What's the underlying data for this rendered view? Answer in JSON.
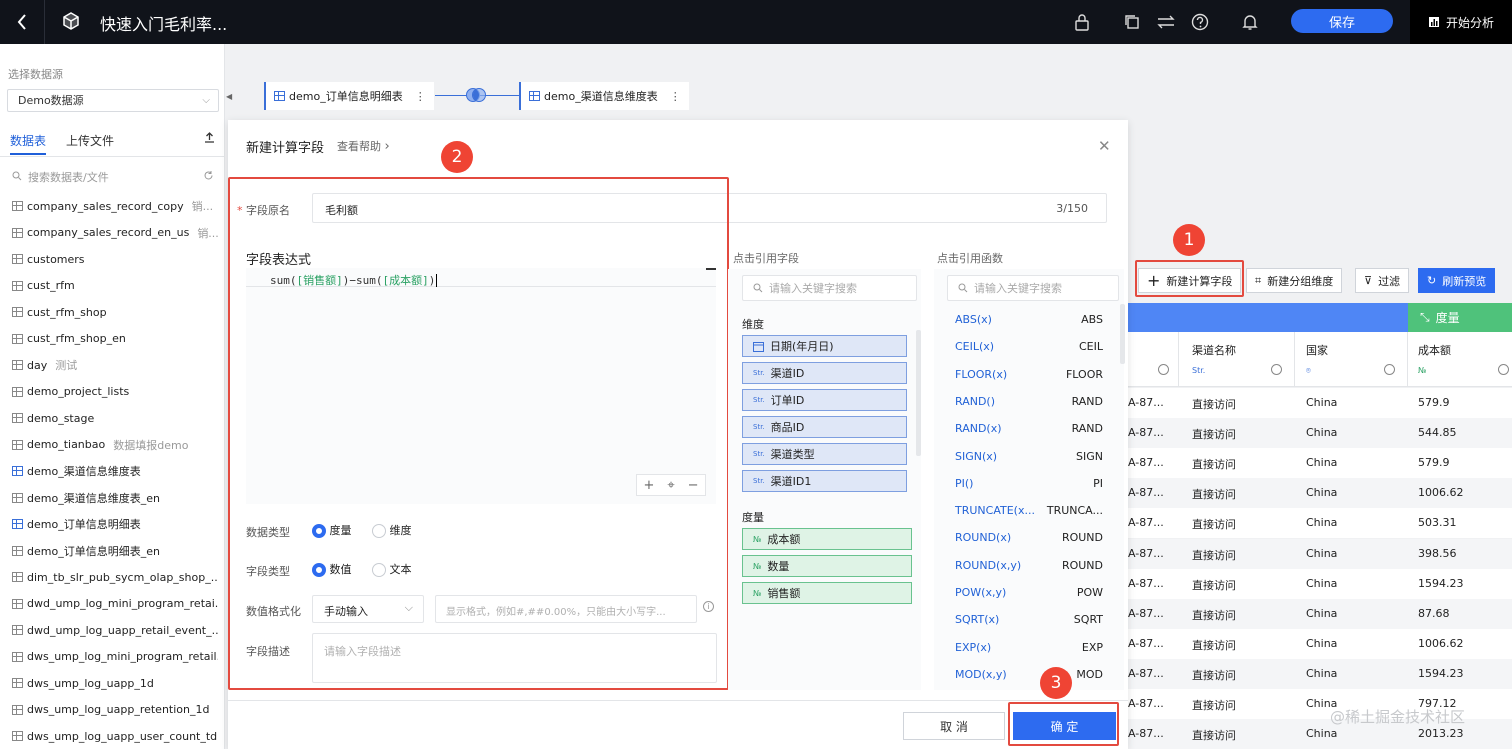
{
  "topbar": {
    "title": "快速入门毛利率...",
    "save_label": "保存",
    "analyze_label": "开始分析"
  },
  "sidebar": {
    "source_label": "选择数据源",
    "source_value": "Demo数据源",
    "tab_tables": "数据表",
    "tab_upload": "上传文件",
    "search_placeholder": "搜索数据表/文件",
    "tables": [
      {
        "name": "company_sales_record_copy",
        "desc": "销..."
      },
      {
        "name": "company_sales_record_en_us",
        "desc": "销..."
      },
      {
        "name": "customers",
        "desc": ""
      },
      {
        "name": "cust_rfm",
        "desc": ""
      },
      {
        "name": "cust_rfm_shop",
        "desc": ""
      },
      {
        "name": "cust_rfm_shop_en",
        "desc": ""
      },
      {
        "name": "day",
        "desc": "测试"
      },
      {
        "name": "demo_project_lists",
        "desc": ""
      },
      {
        "name": "demo_stage",
        "desc": ""
      },
      {
        "name": "demo_tianbao",
        "desc": "数据填报demo"
      },
      {
        "name": "demo_渠道信息维度表",
        "desc": ""
      },
      {
        "name": "demo_渠道信息维度表_en",
        "desc": ""
      },
      {
        "name": "demo_订单信息明细表",
        "desc": ""
      },
      {
        "name": "demo_订单信息明细表_en",
        "desc": ""
      },
      {
        "name": "dim_tb_slr_pub_sycm_olap_shop_...",
        "desc": ""
      },
      {
        "name": "dwd_ump_log_mini_program_retai...",
        "desc": ""
      },
      {
        "name": "dwd_ump_log_uapp_retail_event_...",
        "desc": ""
      },
      {
        "name": "dws_ump_log_mini_program_retail...",
        "desc": ""
      },
      {
        "name": "dws_ump_log_uapp_1d",
        "desc": ""
      },
      {
        "name": "dws_ump_log_uapp_retention_1d",
        "desc": ""
      },
      {
        "name": "dws_ump_log_uapp_user_count_td",
        "desc": ""
      }
    ]
  },
  "canvas": {
    "node_left": "demo_订单信息明细表",
    "node_right": "demo_渠道信息维度表"
  },
  "dialog": {
    "title": "新建计算字段",
    "help": "查看帮助",
    "field_name_label": "字段原名",
    "field_name_value": "毛利额",
    "field_name_count": "3/150",
    "expr_label": "字段表达式",
    "expr_fn": "sum(",
    "expr_ref1": "[销售额]",
    "expr_mid": ")−sum(",
    "expr_ref2": "[成本额]",
    "expr_end": ")",
    "data_type_label": "数据类型",
    "data_type_opt1": "度量",
    "data_type_opt2": "维度",
    "field_type_label": "字段类型",
    "field_type_opt1": "数值",
    "field_type_opt2": "文本",
    "format_label": "数值格式化",
    "format_value": "手动输入",
    "format_placeholder": "显示格式，例如#,##0.00%，只能由大小写字...",
    "desc_label": "字段描述",
    "desc_placeholder": "请输入字段描述",
    "fields_title": "点击引用字段",
    "fields_search": "请输入关键字搜索",
    "dim_title": "维度",
    "dims": [
      {
        "tag": "date",
        "name": "日期(年月日)"
      },
      {
        "tag": "Str.",
        "name": "渠道ID"
      },
      {
        "tag": "Str.",
        "name": "订单ID"
      },
      {
        "tag": "Str.",
        "name": "商品ID"
      },
      {
        "tag": "Str.",
        "name": "渠道类型"
      },
      {
        "tag": "Str.",
        "name": "渠道ID1"
      }
    ],
    "measure_title": "度量",
    "measures": [
      {
        "tag": "№",
        "name": "成本额"
      },
      {
        "tag": "№",
        "name": "数量"
      },
      {
        "tag": "№",
        "name": "销售额"
      }
    ],
    "funcs_title": "点击引用函数",
    "funcs_search": "请输入关键字搜索",
    "funcs": [
      {
        "name": "ABS(x)",
        "code": "ABS"
      },
      {
        "name": "CEIL(x)",
        "code": "CEIL"
      },
      {
        "name": "FLOOR(x)",
        "code": "FLOOR"
      },
      {
        "name": "RAND()",
        "code": "RAND"
      },
      {
        "name": "RAND(x)",
        "code": "RAND"
      },
      {
        "name": "SIGN(x)",
        "code": "SIGN"
      },
      {
        "name": "PI()",
        "code": "PI"
      },
      {
        "name": "TRUNCATE(x...",
        "code": "TRUNCA..."
      },
      {
        "name": "ROUND(x)",
        "code": "ROUND"
      },
      {
        "name": "ROUND(x,y)",
        "code": "ROUND"
      },
      {
        "name": "POW(x,y)",
        "code": "POW"
      },
      {
        "name": "SQRT(x)",
        "code": "SQRT"
      },
      {
        "name": "EXP(x)",
        "code": "EXP"
      },
      {
        "name": "MOD(x,y)",
        "code": "MOD"
      }
    ],
    "cancel_label": "取 消",
    "ok_label": "确 定"
  },
  "toolbar": {
    "new_calc": "新建计算字段",
    "new_group": "新建分组维度",
    "filter": "过滤",
    "refresh": "刷新预览"
  },
  "grid": {
    "measure_header": "度量",
    "col_channel": "渠道名称",
    "col_country": "国家",
    "col_cost": "成本额",
    "tag_str": "Str.",
    "tag_num": "№",
    "rows": [
      {
        "id": "A-87...",
        "channel": "直接访问",
        "country": "China",
        "cost": "579.9"
      },
      {
        "id": "A-87...",
        "channel": "直接访问",
        "country": "China",
        "cost": "544.85"
      },
      {
        "id": "A-87...",
        "channel": "直接访问",
        "country": "China",
        "cost": "579.9"
      },
      {
        "id": "A-87...",
        "channel": "直接访问",
        "country": "China",
        "cost": "1006.62"
      },
      {
        "id": "A-87...",
        "channel": "直接访问",
        "country": "China",
        "cost": "503.31"
      },
      {
        "id": "A-87...",
        "channel": "直接访问",
        "country": "China",
        "cost": "398.56"
      },
      {
        "id": "A-87...",
        "channel": "直接访问",
        "country": "China",
        "cost": "1594.23"
      },
      {
        "id": "A-87...",
        "channel": "直接访问",
        "country": "China",
        "cost": "87.68"
      },
      {
        "id": "A-87...",
        "channel": "直接访问",
        "country": "China",
        "cost": "1006.62"
      },
      {
        "id": "A-87...",
        "channel": "直接访问",
        "country": "China",
        "cost": "1594.23"
      },
      {
        "id": "A-87...",
        "channel": "直接访问",
        "country": "China",
        "cost": "797.12"
      },
      {
        "id": "A-87...",
        "channel": "直接访问",
        "country": "China",
        "cost": "2013.23"
      }
    ]
  },
  "annotations": {
    "b1": "1",
    "b2": "2",
    "b3": "3"
  },
  "watermark": "@稀土掘金技术社区",
  "colors": {
    "accent": "#2d6bf0",
    "highlight": "#e34a3f",
    "measure": "#4fc27b"
  }
}
